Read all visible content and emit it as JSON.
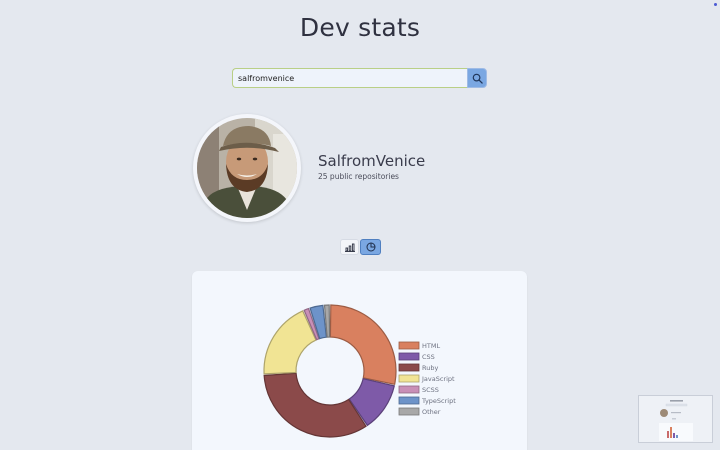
{
  "page": {
    "title": "Dev stats"
  },
  "search": {
    "value": "salfromvenice",
    "button_icon": "search-icon"
  },
  "profile": {
    "name": "SalfromVenice",
    "repos_label": "25 public repositories"
  },
  "view_toggle": {
    "options": [
      {
        "icon": "bar-chart-icon",
        "active": false
      },
      {
        "icon": "pie-chart-icon",
        "active": true
      }
    ],
    "active_color": "#7aa7e2"
  },
  "chart_data": {
    "type": "pie",
    "variant": "doughnut",
    "title": "",
    "labels": [
      "HTML",
      "CSS",
      "Ruby",
      "JavaScript",
      "SCSS",
      "TypeScript",
      "Other"
    ],
    "values": [
      28.0,
      12.0,
      33.0,
      19.0,
      1.5,
      3.5,
      1.5
    ],
    "colors": [
      "#d9805f",
      "#7e5aa8",
      "#8b4a4a",
      "#f1e494",
      "#c98fb7",
      "#6d93c9",
      "#a8a8a8"
    ],
    "legend_position": "right"
  }
}
